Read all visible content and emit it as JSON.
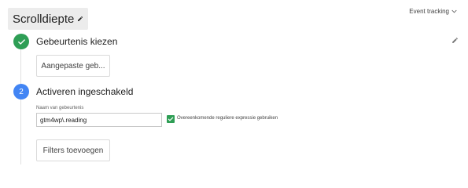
{
  "header": {
    "title": "Scrolldiepte",
    "top_right_label": "Event tracking"
  },
  "steps": [
    {
      "title": "Gebeurtenis kiezen",
      "button_label": "Aangepaste geb..."
    },
    {
      "number": "2",
      "title": "Activeren ingeschakeld",
      "field_label": "Naam van gebeurtenis",
      "field_value": "gtm4wp\\.reading",
      "checkbox_label": "Overeenkomende reguliere expressie gebruiken",
      "checkbox_checked": true,
      "filters_button_label": "Filters toevoegen"
    }
  ],
  "colors": {
    "success_green": "#2e9e55",
    "step_blue": "#4285f4"
  }
}
